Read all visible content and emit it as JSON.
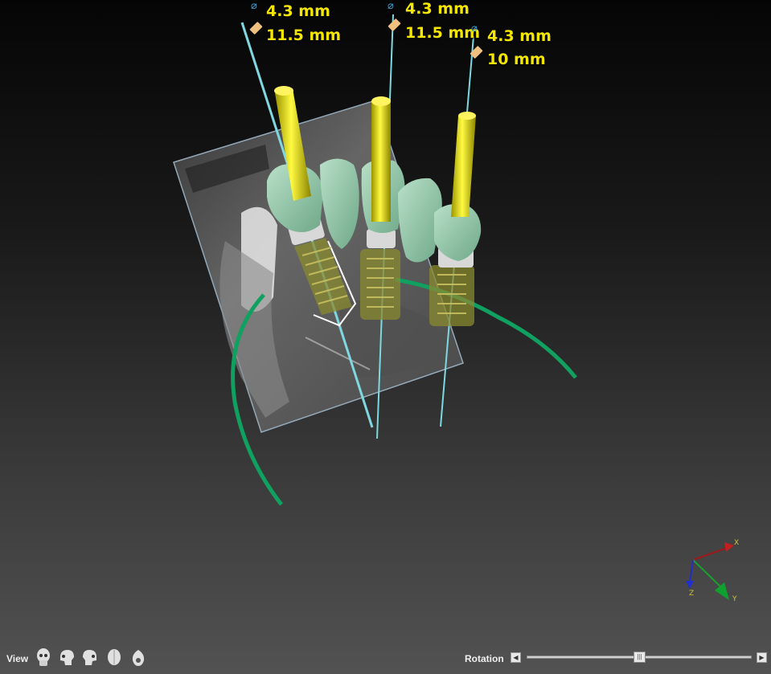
{
  "implants": [
    {
      "diameter": "4.3 mm",
      "length": "11.5 mm"
    },
    {
      "diameter": "4.3 mm",
      "length": "11.5 mm"
    },
    {
      "diameter": "4.3 mm",
      "length": "10 mm"
    }
  ],
  "axes": {
    "x": "X",
    "y": "Y",
    "z": "Z"
  },
  "toolbar": {
    "view_label": "View",
    "view_buttons": [
      "skull-front-icon",
      "skull-left-icon",
      "skull-right-icon",
      "skull-top-icon",
      "skull-bottom-icon"
    ],
    "rotation_label": "Rotation",
    "rotation_value": 0.5
  },
  "colors": {
    "label": "#f5e600",
    "drill_axis": "#7fd8e0",
    "implant_post": "#e6e000",
    "crown": "#8fc8a8",
    "nerve_canal": "#10a060"
  }
}
